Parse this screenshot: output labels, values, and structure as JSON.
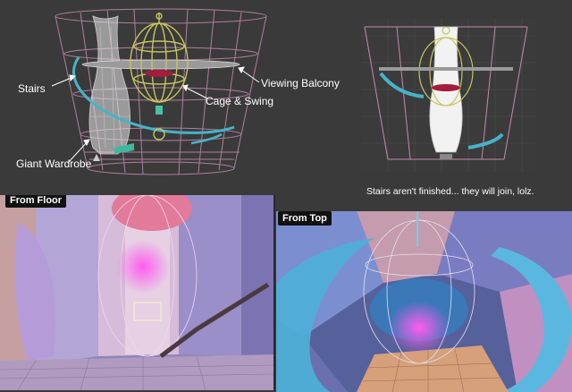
{
  "wireframe_labels": {
    "stairs": "Stairs",
    "giant_wardrobe": "Giant Wardrobe",
    "cage_swing": "Cage & Swing",
    "viewing_balcony": "Viewing Balcony"
  },
  "caption": "Stairs aren't finished... they will join, lolz.",
  "views": {
    "from_floor": "From Floor",
    "from_top": "From Top"
  },
  "colors": {
    "background": "#3a3a3a",
    "wire_pink": "#d898c0",
    "stairs_cyan": "#46b3c8",
    "cage_yellow": "#c8c864",
    "glow_magenta": "#e040e0"
  }
}
